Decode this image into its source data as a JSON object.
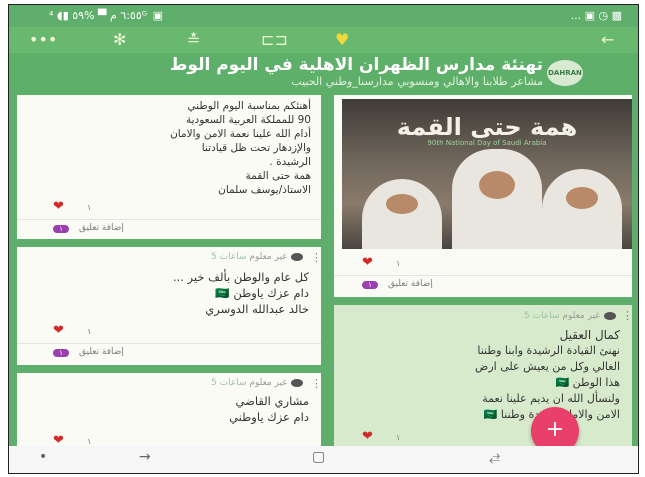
{
  "status_bar": {
    "left_text": "٦:٥٥ م ▀ %٥٩ ▮◖ ⁴ᴳ ▣",
    "right_text": "... ▣ ◷ ▩"
  },
  "toolbar": {
    "back_icon": "arrow-right-icon",
    "heart_icon": "heart-icon",
    "slideshow_icon": "slideshow-icon",
    "sliders_icon": "sliders-icon",
    "gear_icon": "gear-icon",
    "more_icon": "more-icon"
  },
  "header": {
    "title": "تهنئة مدارس الظهران الاهلية في اليوم الوط",
    "subtitle": "مشاعر طلابنا والاهالي ومنسوبي مدارسنا_وطني الحبيب",
    "logo_text": "DAHRAN"
  },
  "colors": {
    "accent": "#5fae6b",
    "heart": "#d62a2a",
    "badge": "#9b3fb0",
    "fab": "#e8406a"
  },
  "posts": {
    "p1": {
      "lines": [
        "أهنئكم بمناسبة اليوم الوطني",
        "90 للمملكة العربية السعودية",
        "أدام الله علينا نعمة الامن والامان",
        "والإزدهار تحت ظل قيادتنا",
        "الرشيدة .",
        "همة حتى القمة",
        "الاستاذ/يوسف سلمان"
      ],
      "likes": "١",
      "comment_badge": "١",
      "comment_label": "إضافة تعليق"
    },
    "p2": {
      "author": "غير معلوم",
      "time": "ساعات 5",
      "lines": [
        "كل عام والوطن بألف خير ...",
        "دام عزك ياوطن 🇸🇦",
        "خالد عبدالله الدوسري"
      ],
      "likes": "١",
      "comment_badge": "١",
      "comment_label": "إضافة تعليق"
    },
    "p3": {
      "author": "غير معلوم",
      "time": "ساعات 5",
      "lines": [
        "مشاري القاضي",
        "دام عزك ياوطني"
      ],
      "likes": "١"
    },
    "p4": {
      "poster_title": "همة حتى القمة",
      "poster_subtitle": "90th National Day of Saudi Arabia",
      "likes": "١",
      "comment_badge": "١",
      "comment_label": "إضافة تعليق"
    },
    "p5": {
      "author": "غير معلوم",
      "time": "ساعات 5",
      "lines": [
        "كمال العقيل",
        "نهنئ القيادة الرشيدة وابنا وطننا",
        "الغالي وكل من يعيش على ارض",
        "هذا الوطن 🇸🇦",
        "ولنسأل الله ان يديم علينا نعمة",
        "الامن والامان ووحدة وطننا 🇸🇦"
      ],
      "likes": "١"
    }
  },
  "fab": {
    "label": "+"
  },
  "nav_bar": {
    "dot": "•",
    "back": "→",
    "home": "▢",
    "recents": "⥄"
  }
}
